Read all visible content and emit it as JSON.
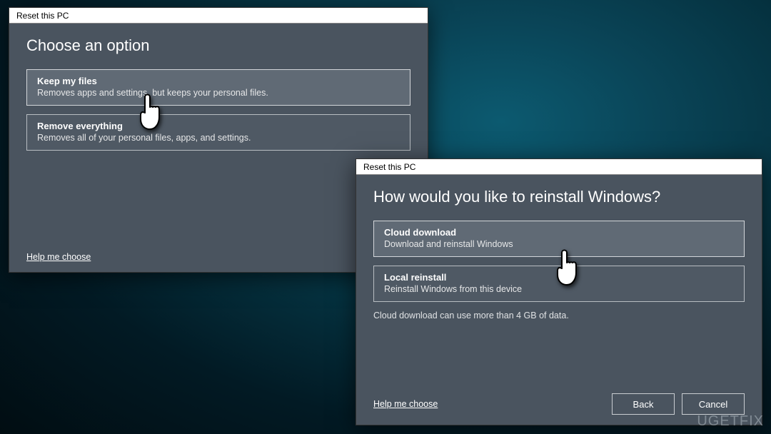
{
  "watermark": "UGETFIX",
  "dialog1": {
    "title": "Reset this PC",
    "heading": "Choose an option",
    "help": "Help me choose",
    "options": [
      {
        "title": "Keep my files",
        "desc": "Removes apps and settings, but keeps your personal files."
      },
      {
        "title": "Remove everything",
        "desc": "Removes all of your personal files, apps, and settings."
      }
    ]
  },
  "dialog2": {
    "title": "Reset this PC",
    "heading": "How would you like to reinstall Windows?",
    "help": "Help me choose",
    "options": [
      {
        "title": "Cloud download",
        "desc": "Download and reinstall Windows"
      },
      {
        "title": "Local reinstall",
        "desc": "Reinstall Windows from this device"
      }
    ],
    "note": "Cloud download can use more than 4 GB of data.",
    "back": "Back",
    "cancel": "Cancel"
  }
}
